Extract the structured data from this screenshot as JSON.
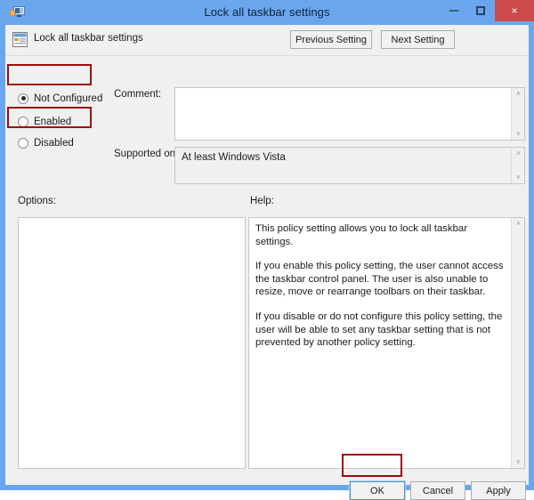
{
  "window": {
    "title": "Lock all taskbar settings",
    "icon": "policy-monitor-icon",
    "controls": {
      "minimize": "minimize-button",
      "maximize": "maximize-button",
      "close_label": "×"
    }
  },
  "header": {
    "icon": "policy-setting-icon",
    "title": "Lock all taskbar settings",
    "previous_label": "Previous Setting",
    "next_label": "Next Setting"
  },
  "state_options": [
    {
      "label": "Not Configured",
      "selected": true
    },
    {
      "label": "Enabled",
      "selected": false
    },
    {
      "label": "Disabled",
      "selected": false
    }
  ],
  "comment": {
    "label": "Comment:",
    "value": "",
    "scroll_up": "˄",
    "scroll_down": "˅"
  },
  "supported": {
    "label": "Supported on:",
    "value": "At least Windows Vista",
    "scroll_up": "˄",
    "scroll_down": "˅"
  },
  "options": {
    "label": "Options:",
    "value": ""
  },
  "help": {
    "label": "Help:",
    "paragraphs": [
      "This policy setting allows you to lock all taskbar settings.",
      "If you enable this policy setting, the user cannot access the taskbar control panel. The user is also unable to resize, move or rearrange toolbars on their taskbar.",
      "If you disable or do not configure this policy setting, the user will be able to set any taskbar setting that is not prevented by another policy setting."
    ],
    "scroll_up": "˄",
    "scroll_down": "˅"
  },
  "buttons": {
    "ok": "OK",
    "cancel": "Cancel",
    "apply": "Apply"
  },
  "highlights": [
    {
      "name": "not-configured-highlight"
    },
    {
      "name": "disabled-highlight"
    },
    {
      "name": "ok-highlight"
    }
  ],
  "colors": {
    "titlebar": "#6aa6ee",
    "close_button": "#cb4b4b",
    "dialog_background": "#f0f0f0",
    "highlight_red": "#9e0b0b",
    "focus_blue": "#4a90d9"
  }
}
